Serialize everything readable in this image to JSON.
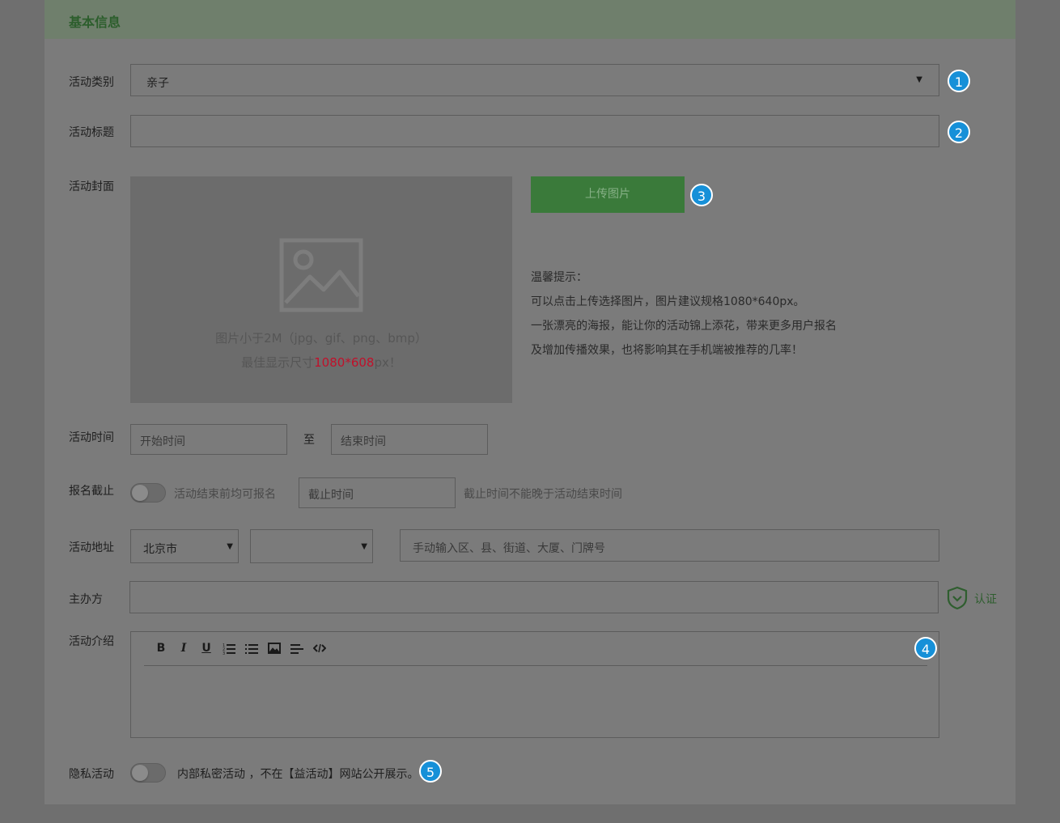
{
  "section": {
    "title": "基本信息"
  },
  "form": {
    "category": {
      "label": "活动类别",
      "value": "亲子",
      "arrow": "▼"
    },
    "title": {
      "label": "活动标题",
      "value": ""
    },
    "cover": {
      "label": "活动封面",
      "upload_button": "上传图片",
      "hint_line1": "图片小于2M（jpg、gif、png、bmp）",
      "hint_line2_prefix": "最佳显示尺寸",
      "hint_line2_size": "1080*608",
      "hint_line2_suffix": "px！",
      "tips": [
        "温馨提示：",
        "可以点击上传选择图片，图片建议规格1080*640px。",
        "一张漂亮的海报，能让你的活动锦上添花，带来更多用户报名",
        "及增加传播效果，也将影响其在手机端被推荐的几率！"
      ]
    },
    "time": {
      "label": "活动时间",
      "start_placeholder": "开始时间",
      "separator": "至",
      "end_placeholder": "结束时间"
    },
    "deadline": {
      "label": "报名截止",
      "toggle_text": "活动结束前均可报名",
      "placeholder": "截止时间",
      "note": "截止时间不能晚于活动结束时间"
    },
    "address": {
      "label": "活动地址",
      "city": "北京市",
      "district": "",
      "detail_placeholder": "手动输入区、县、街道、大厦、门牌号"
    },
    "organizer": {
      "label": "主办方",
      "value": "",
      "verify": "认证"
    },
    "intro": {
      "label": "活动介绍",
      "toolbar": [
        "B",
        "I",
        "U",
        "ordered-list",
        "unordered-list",
        "image",
        "align",
        "code"
      ]
    },
    "privacy": {
      "label": "隐私活动",
      "text": "内部私密活动 ，不在【益活动】网站公开展示。"
    }
  },
  "badges": [
    "1",
    "2",
    "3",
    "4",
    "5"
  ],
  "colors": {
    "badge": "#1690d8",
    "upload_button": "#3a7a3a",
    "highlight": "#c0112b",
    "header_title": "#2c5e2c"
  }
}
